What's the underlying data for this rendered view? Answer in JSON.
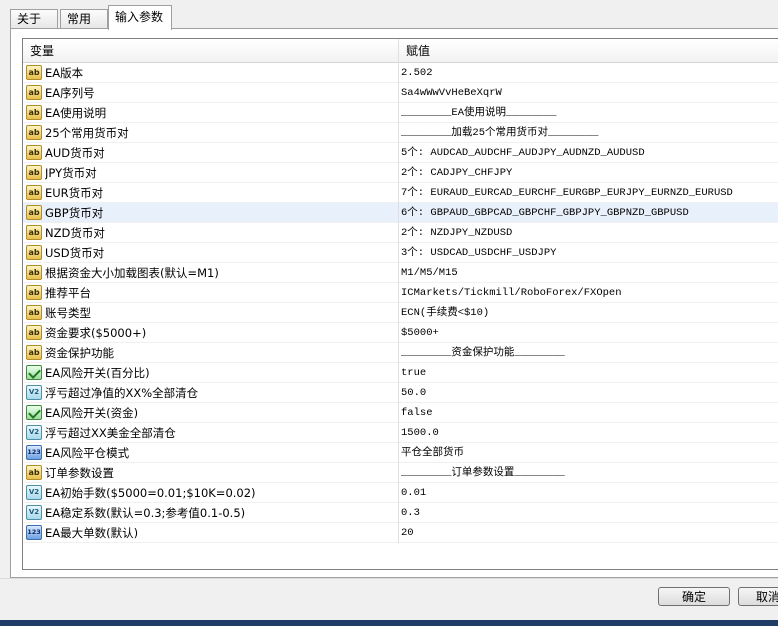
{
  "tabs": [
    {
      "label": "关于"
    },
    {
      "label": "常用"
    },
    {
      "label": "输入参数"
    }
  ],
  "grid": {
    "headers": {
      "variable": "变量",
      "value": "赋值"
    },
    "rows": [
      {
        "icon": "ab",
        "name": "EA版本",
        "value": "2.502"
      },
      {
        "icon": "ab",
        "name": "EA序列号",
        "value": "Sa4wWwVvHeBeXqrW"
      },
      {
        "icon": "ab",
        "name": "EA使用说明",
        "value": "________EA使用说明________"
      },
      {
        "icon": "ab",
        "name": "25个常用货币对",
        "value": "________加载25个常用货币对________"
      },
      {
        "icon": "ab",
        "name": "AUD货币对",
        "value": "5个: AUDCAD_AUDCHF_AUDJPY_AUDNZD_AUDUSD"
      },
      {
        "icon": "ab",
        "name": "JPY货币对",
        "value": "2个: CADJPY_CHFJPY"
      },
      {
        "icon": "ab",
        "name": "EUR货币对",
        "value": "7个: EURAUD_EURCAD_EURCHF_EURGBP_EURJPY_EURNZD_EURUSD"
      },
      {
        "icon": "ab",
        "name": "GBP货币对",
        "value": "6个: GBPAUD_GBPCAD_GBPCHF_GBPJPY_GBPNZD_GBPUSD",
        "highlight": true
      },
      {
        "icon": "ab",
        "name": "NZD货币对",
        "value": "2个: NZDJPY_NZDUSD"
      },
      {
        "icon": "ab",
        "name": "USD货币对",
        "value": "3个: USDCAD_USDCHF_USDJPY"
      },
      {
        "icon": "ab",
        "name": "根据资金大小加载图表(默认=M1)",
        "value": "M1/M5/M15"
      },
      {
        "icon": "ab",
        "name": "推荐平台",
        "value": "ICMarkets/Tickmill/RoboForex/FXOpen"
      },
      {
        "icon": "ab",
        "name": "账号类型",
        "value": "ECN(手续费<$10)"
      },
      {
        "icon": "ab",
        "name": "资金要求($5000+)",
        "value": "$5000+"
      },
      {
        "icon": "ab",
        "name": "资金保护功能",
        "value": "________资金保护功能________"
      },
      {
        "icon": "bool",
        "name": "EA风险开关(百分比)",
        "value": "true"
      },
      {
        "icon": "dbl",
        "name": "浮亏超过净值的XX%全部清仓",
        "value": "50.0"
      },
      {
        "icon": "bool",
        "name": "EA风险开关(资金)",
        "value": "false"
      },
      {
        "icon": "dbl",
        "name": "浮亏超过XX美金全部清仓",
        "value": "1500.0"
      },
      {
        "icon": "num",
        "name": "EA风险平仓模式",
        "value": "平仓全部货币"
      },
      {
        "icon": "ab",
        "name": "订单参数设置",
        "value": "________订单参数设置________"
      },
      {
        "icon": "dbl",
        "name": "EA初始手数($5000=0.01;$10K=0.02)",
        "value": "0.01"
      },
      {
        "icon": "dbl",
        "name": "EA稳定系数(默认=0.3;参考值0.1-0.5)",
        "value": "0.3"
      },
      {
        "icon": "num",
        "name": "EA最大单数(默认)",
        "value": "20"
      }
    ]
  },
  "icon_glyphs": {
    "ab": "ab",
    "num": "123",
    "dbl": "V2",
    "bool": ""
  },
  "buttons": {
    "ok": "确定",
    "cancel": "取消"
  },
  "colors": {
    "highlight_row": "#e8f1fb",
    "taskbar": "#1f3d66"
  }
}
